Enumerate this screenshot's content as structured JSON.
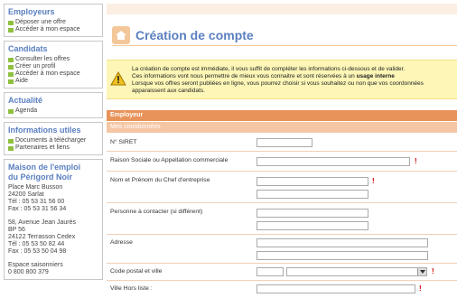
{
  "sidebar": {
    "employeurs": {
      "title": "Employeurs",
      "items": [
        "Déposer une offre",
        "Accéder à mon espace"
      ]
    },
    "candidats": {
      "title": "Candidats",
      "items": [
        "Consulter les offres",
        "Créer un profil",
        "Accéder à mon espace",
        "Aide"
      ]
    },
    "actualite": {
      "title": "Actualité",
      "items": [
        "Agenda"
      ]
    },
    "infos": {
      "title": "Informations utiles",
      "items": [
        "Documents à télécharger",
        "Partenaires et liens"
      ]
    },
    "maison": {
      "title": "Maison de l'emploi\ndu Périgord Noir",
      "address1": "Place Marc Busson\n24200 Sarlat\nTél : 05 53 31 56 00\nFax : 05 53 31 56 34",
      "address2": "58, Avenue Jean Jaurès\nBP 56\n24122 Terrasson Cedex\nTél : 05 53 50 82 44\nFax : 05 53 50 04 98",
      "saisonniers": "Espace saisonniers\n0 800 800 379"
    }
  },
  "main": {
    "title": "Création de compte",
    "notice_line1": "La création de compte est immédiate, il vous suffit de compléter les informations ci-dessous et de valider.",
    "notice_line2_a": "Ces informations vont nous permettre de mieux vous connaitre et sont réservées à un ",
    "notice_line2_b": "usage interne",
    "notice_line3": "Lorsque vos offres seront publiées en ligne, vous pourrez choisir si vous souhaitez ou non que vos coordonnées apparaissent aux candidats.",
    "section": "Employeur",
    "subsection": "Mes coordonnées",
    "fields": {
      "siret": "N° SIRET",
      "raison": "Raison Sociale ou Appellation commerciale",
      "chef": "Nom et Prénom du Chef d'entreprise",
      "contact": "Personne à contacter (si différent)",
      "adresse": "Adresse",
      "cp": "Code postal et ville",
      "horsliste": "Ville Hors liste :"
    },
    "required_mark": "!"
  },
  "colors": {
    "heading": "#5a7fc0",
    "section": "#e8935a",
    "subsection": "#f4c6a4",
    "notice": "#fdf6b6",
    "bullet": "#8fbf3f",
    "required": "#cc0000"
  }
}
